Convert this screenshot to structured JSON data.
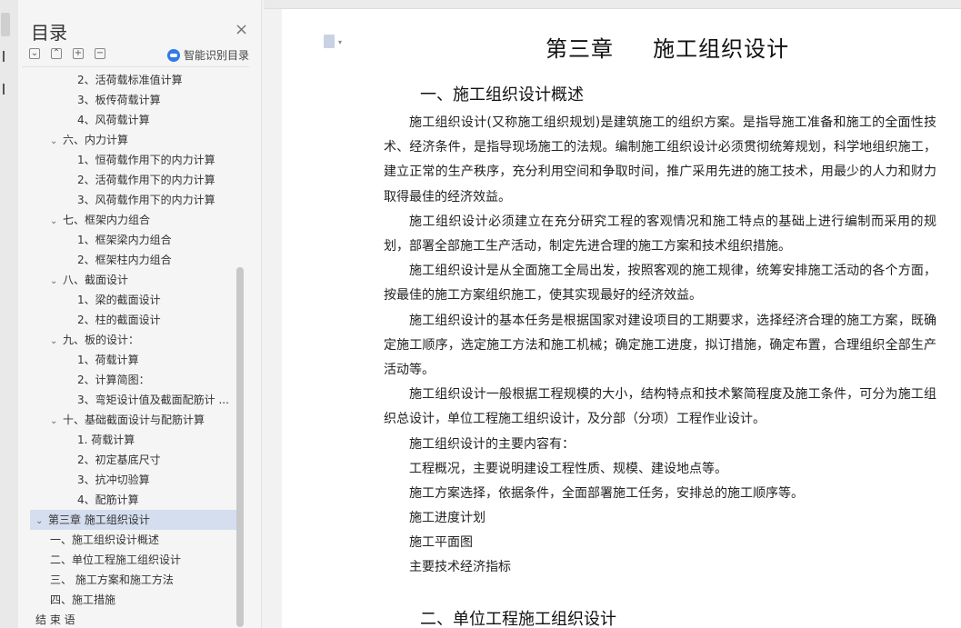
{
  "toc": {
    "title": "目录",
    "close_icon": "×",
    "smart_label": "智能识别目录",
    "items": [
      {
        "label": "2、活荷载标准值计算",
        "level": 2
      },
      {
        "label": "3、板传荷载计算",
        "level": 2
      },
      {
        "label": "4、风荷载计算",
        "level": 2
      },
      {
        "label": "六、内力计算",
        "level": 1,
        "expanded": true
      },
      {
        "label": "1、恒荷载作用下的内力计算",
        "level": 2
      },
      {
        "label": "2、活荷载作用下的内力计算",
        "level": 2
      },
      {
        "label": "3、风荷载作用下的内力计算",
        "level": 2
      },
      {
        "label": "七、框架内力组合",
        "level": 1,
        "expanded": true
      },
      {
        "label": "1、框架梁内力组合",
        "level": 2
      },
      {
        "label": "2、框架柱内力组合",
        "level": 2
      },
      {
        "label": "八、截面设计",
        "level": 1,
        "expanded": true
      },
      {
        "label": "1、梁的截面设计",
        "level": 2
      },
      {
        "label": "2、柱的截面设计",
        "level": 2
      },
      {
        "label": "九、板的设计：",
        "level": 1,
        "expanded": true
      },
      {
        "label": "1、荷载计算",
        "level": 2
      },
      {
        "label": "2、计算简图：",
        "level": 2
      },
      {
        "label": "3、弯矩设计值及截面配筋计 ...",
        "level": 2
      },
      {
        "label": "十、基础截面设计与配筋计算",
        "level": 1,
        "expanded": true
      },
      {
        "label": "1. 荷载计算",
        "level": 2
      },
      {
        "label": "2、初定基底尺寸",
        "level": 2
      },
      {
        "label": "3、抗冲切验算",
        "level": 2
      },
      {
        "label": "4、配筋计算",
        "level": 2
      },
      {
        "label": "第三章    施工组织设计",
        "level": 0,
        "expanded": true,
        "selected": true
      },
      {
        "label": "一、施工组织设计概述",
        "level": 1
      },
      {
        "label": "二、单位工程施工组织设计",
        "level": 1
      },
      {
        "label": "三、 施工方案和施工方法",
        "level": 1
      },
      {
        "label": "四、施工措施",
        "level": 1
      },
      {
        "label": "结 束 语",
        "level": 0
      }
    ]
  },
  "doc": {
    "chapter_title": "第三章     施工组织设计",
    "section1_title": "一、施工组织设计概述",
    "paragraphs": [
      "施工组织设计(又称施工组织规划)是建筑施工的组织方案。是指导施工准备和施工的全面性技术、经济条件，是指导现场施工的法规。编制施工组织设计必须贯彻统筹规划，科学地组织施工，建立正常的生产秩序，充分利用空间和争取时间，推广采用先进的施工技术，用最少的人力和财力取得最佳的经济效益。",
      "施工组织设计必须建立在充分研究工程的客观情况和施工特点的基础上进行编制而采用的规划，部署全部施工生产活动，制定先进合理的施工方案和技术组织措施。",
      "施工组织设计是从全面施工全局出发，按照客观的施工规律，统筹安排施工活动的各个方面，按最佳的施工方案组织施工，使其实现最好的经济效益。",
      "施工组织设计的基本任务是根据国家对建设项目的工期要求，选择经济合理的施工方案，既确定施工顺序，选定施工方法和施工机械；确定施工进度，拟订措施，确定布置，合理组织全部生产活动等。",
      "施工组织设计一般根据工程规模的大小，结构特点和技术繁简程度及施工条件，可分为施工组织总设计，单位工程施工组织设计，及分部（分项）工程作业设计。"
    ],
    "lines": [
      "施工组织设计的主要内容有：",
      "工程概况，主要说明建设工程性质、规模、建设地点等。",
      "施工方案选择，依据条件，全面部署施工任务，安排总的施工顺序等。",
      "施工进度计划",
      "施工平面图",
      "主要技术经济指标"
    ],
    "section2_title": "二、单位工程施工组织设计"
  }
}
